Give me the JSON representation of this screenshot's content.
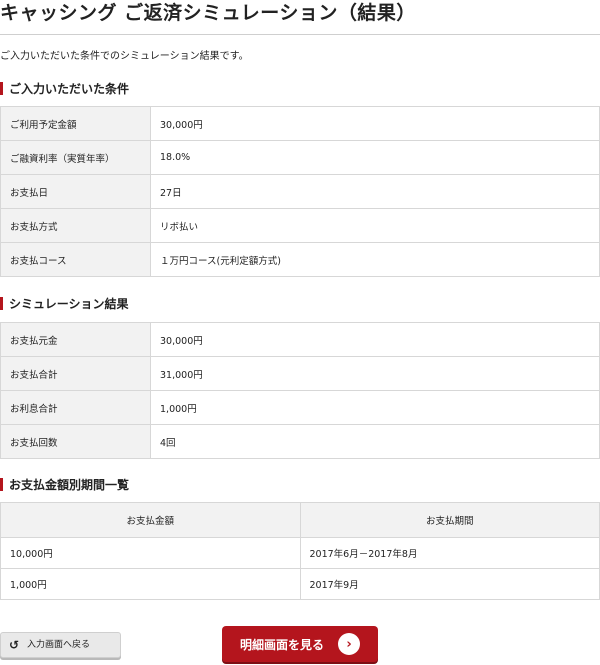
{
  "page": {
    "title": "キャッシング ご返済シミュレーション（結果）",
    "intro": "ご入力いただいた条件でのシミュレーション結果です。"
  },
  "conditions": {
    "heading": "ご入力いただいた条件",
    "rows": [
      {
        "label": "ご利用予定金額",
        "value": "30,000円"
      },
      {
        "label": "ご融資利率（実質年率）",
        "value": "18.0%"
      },
      {
        "label": "お支払日",
        "value": "27日"
      },
      {
        "label": "お支払方式",
        "value": "リボ払い"
      },
      {
        "label": "お支払コース",
        "value": "１万円コース(元利定額方式)"
      }
    ]
  },
  "results": {
    "heading": "シミュレーション結果",
    "rows": [
      {
        "label": "お支払元金",
        "value": "30,000円"
      },
      {
        "label": "お支払合計",
        "value": "31,000円"
      },
      {
        "label": "お利息合計",
        "value": "1,000円"
      },
      {
        "label": "お支払回数",
        "value": "4回"
      }
    ]
  },
  "schedule": {
    "heading": "お支払金額別期間一覧",
    "columns": [
      "お支払金額",
      "お支払期間"
    ],
    "rows": [
      {
        "amount": "10,000円",
        "period": "2017年6月－2017年8月"
      },
      {
        "amount": "1,000円",
        "period": "2017年9月"
      }
    ]
  },
  "buttons": {
    "back_label": "入力画面へ戻る",
    "back_icon": "return-arrow-icon",
    "detail_label": "明細画面を見る",
    "detail_icon": "chevron-right-circle-icon"
  },
  "colors": {
    "accent": "#b4151d",
    "key_bg": "#f2f2f2",
    "border": "#d7d7d7"
  }
}
